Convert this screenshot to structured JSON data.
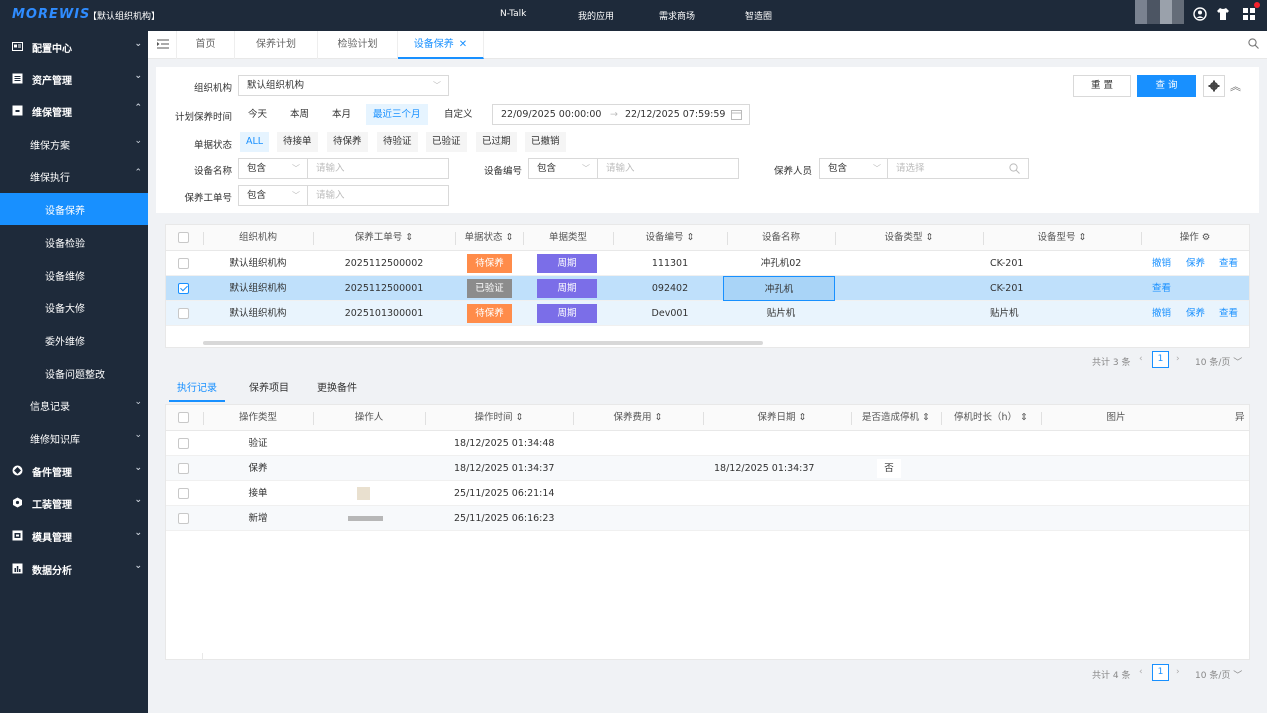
{
  "topbar": {
    "logo": "MOREWIS",
    "org": "【默认组织机构】",
    "nav": [
      "N-Talk",
      "我的应用",
      "需求商场",
      "智造圈"
    ]
  },
  "sidebar": {
    "items": [
      {
        "label": "配置中心",
        "icon": "config-icon"
      },
      {
        "label": "资产管理",
        "icon": "asset-icon"
      },
      {
        "label": "维保管理",
        "icon": "maintenance-icon"
      },
      {
        "label": "维保方案"
      },
      {
        "label": "维保执行"
      },
      {
        "label": "设备保养"
      },
      {
        "label": "设备检验"
      },
      {
        "label": "设备维修"
      },
      {
        "label": "设备大修"
      },
      {
        "label": "委外维修"
      },
      {
        "label": "设备问题整改"
      },
      {
        "label": "信息记录"
      },
      {
        "label": "维修知识库"
      },
      {
        "label": "备件管理",
        "icon": "spare-parts-icon"
      },
      {
        "label": "工装管理",
        "icon": "tooling-icon"
      },
      {
        "label": "模具管理",
        "icon": "mold-icon"
      },
      {
        "label": "数据分析",
        "icon": "chart-icon"
      }
    ]
  },
  "tabs": [
    "首页",
    "保养计划",
    "检验计划",
    "设备保养"
  ],
  "filter": {
    "org_label": "组织机构",
    "org_value": "默认组织机构",
    "plan_time_label": "计划保养时间",
    "quick_ranges": [
      "今天",
      "本周",
      "本月",
      "最近三个月",
      "自定义"
    ],
    "date_start": "22/09/2025 00:00:00",
    "date_end": "22/12/2025 07:59:59",
    "date_sep": "→",
    "status_label": "单据状态",
    "statuses": [
      "ALL",
      "待接单",
      "待保养",
      "待验证",
      "已验证",
      "已过期",
      "已撤销"
    ],
    "device_name_label": "设备名称",
    "device_no_label": "设备编号",
    "person_label": "保养人员",
    "workorder_label": "保养工单号",
    "contains": "包含",
    "input_placeholder": "请输入",
    "select_placeholder": "请选择",
    "reset_label": "重 置",
    "query_label": "查 询"
  },
  "main_table": {
    "headers": [
      "组织机构",
      "保养工单号",
      "单据状态",
      "单据类型",
      "设备编号",
      "设备名称",
      "设备类型",
      "设备型号",
      "操作"
    ],
    "rows": [
      {
        "org": "默认组织机构",
        "order": "2025112500002",
        "status": "待保养",
        "status_color": "#ff8c4a",
        "type": "周期",
        "device_no": "111301",
        "device_name": "冲孔机02",
        "device_type": "",
        "model": "CK-201",
        "actions": [
          "撤销",
          "保养",
          "查看"
        ],
        "checked": false
      },
      {
        "org": "默认组织机构",
        "order": "2025112500001",
        "status": "已验证",
        "status_color": "#8c8c8c",
        "type": "周期",
        "device_no": "092402",
        "device_name": "冲孔机",
        "device_type": "",
        "model": "CK-201",
        "actions": [
          "查看"
        ],
        "checked": true
      },
      {
        "org": "默认组织机构",
        "order": "2025101300001",
        "status": "待保养",
        "status_color": "#ff8c4a",
        "type": "周期",
        "device_no": "Dev001",
        "device_name": "贴片机",
        "device_type": "",
        "model": "贴片机",
        "actions": [
          "撤销",
          "保养",
          "查看"
        ],
        "checked": false
      }
    ],
    "type_color": "#7b6ee8",
    "pager_total": "共计 3 条",
    "pager_page": "1",
    "pager_size": "10 条/页"
  },
  "detail_tabs": [
    "执行记录",
    "保养项目",
    "更换备件"
  ],
  "detail_table": {
    "headers": [
      "操作类型",
      "操作人",
      "操作时间",
      "保养费用",
      "保养日期",
      "是否造成停机",
      "停机时长（h）",
      "图片",
      "异"
    ],
    "rows": [
      {
        "op": "验证",
        "time": "18/12/2025 01:34:48",
        "cost": "",
        "date": "",
        "stop": ""
      },
      {
        "op": "保养",
        "time": "18/12/2025 01:34:37",
        "cost": "",
        "date": "18/12/2025 01:34:37",
        "stop": "否"
      },
      {
        "op": "接单",
        "time": "25/11/2025 06:21:14",
        "cost": "",
        "date": "",
        "stop": ""
      },
      {
        "op": "新增",
        "time": "25/11/2025 06:16:23",
        "cost": "",
        "date": "",
        "stop": ""
      }
    ],
    "pager_total": "共计 4 条",
    "pager_page": "1",
    "pager_size": "10 条/页"
  }
}
